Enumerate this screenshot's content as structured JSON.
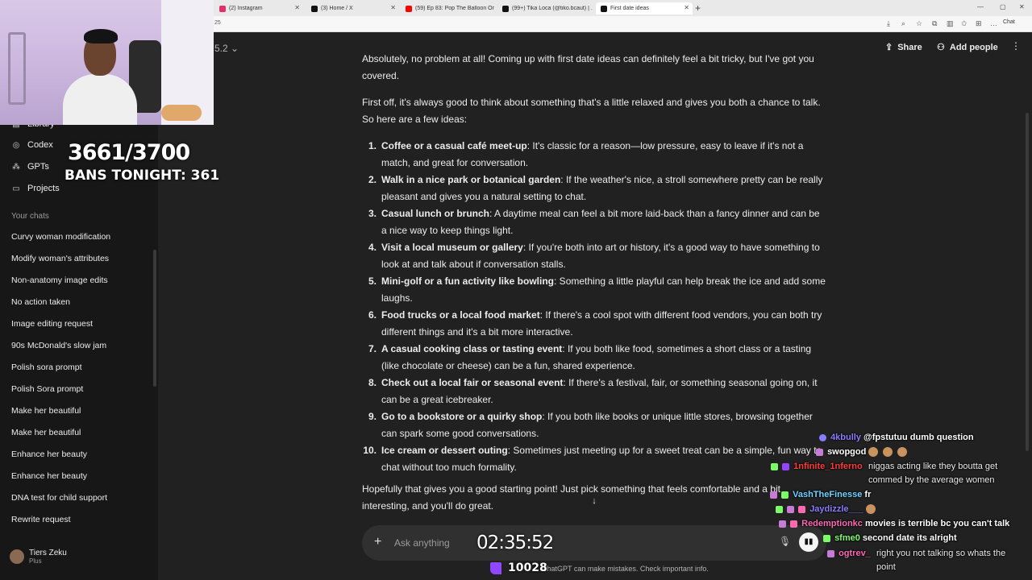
{
  "browser": {
    "tabs": [
      {
        "title": "(2) Instagram",
        "color": "#e1306c"
      },
      {
        "title": "(3) Home / X",
        "color": "#111111"
      },
      {
        "title": "(59) Ep 83: Pop The Balloon Or Fi...",
        "color": "#ff0000"
      },
      {
        "title": "(99+) Tika Loca (@tiko.bcaut) | ...",
        "color": "#111111"
      },
      {
        "title": "First date ideas",
        "color": "#111111"
      }
    ],
    "new_tab": "+",
    "address_fragment": "25",
    "chat_label": "Chat"
  },
  "stream": {
    "ban_count": "3661/3700",
    "bans_tonight": "BANS TONIGHT: 361",
    "timer": "02:35:52",
    "viewers": "10028"
  },
  "sidebar": {
    "top_items": [
      {
        "label": "Library",
        "icon": "library-icon"
      },
      {
        "label": "Codex",
        "icon": "codex-icon"
      },
      {
        "label": "GPTs",
        "icon": "gpts-icon"
      },
      {
        "label": "Projects",
        "icon": "folder-icon"
      }
    ],
    "section_label": "Your chats",
    "chats": [
      "Curvy woman modification",
      "Modify woman's attributes",
      "Non-anatomy image edits",
      "No action taken",
      "Image editing request",
      "90s McDonald's slow jam",
      "Polish sora prompt",
      "Polish Sora prompt",
      "Make her beautiful",
      "Make her beautiful",
      "Enhance her beauty",
      "Enhance her beauty",
      "DNA test for child support",
      "Rewrite request"
    ],
    "user": {
      "name": "Tiers Zeku",
      "plan": "Plus"
    }
  },
  "header": {
    "model": "5.2",
    "share_label": "Share",
    "add_people_label": "Add people"
  },
  "content": {
    "intro": "Absolutely, no problem at all! Coming up with first date ideas can definitely feel a bit tricky, but I've got you covered.",
    "lead": "First off, it's always good to think about something that's a little relaxed and gives you both a chance to talk. So here are a few ideas:",
    "ideas": [
      {
        "num": "1.",
        "title": "Coffee or a casual café meet-up",
        "text": ": It's classic for a reason—low pressure, easy to leave if it's not a match, and great for conversation."
      },
      {
        "num": "2.",
        "title": "Walk in a nice park or botanical garden",
        "text": ": If the weather's nice, a stroll somewhere pretty can be really pleasant and gives you a natural setting to chat."
      },
      {
        "num": "3.",
        "title": "Casual lunch or brunch",
        "text": ": A daytime meal can feel a bit more laid-back than a fancy dinner and can be a nice way to keep things light."
      },
      {
        "num": "4.",
        "title": "Visit a local museum or gallery",
        "text": ": If you're both into art or history, it's a good way to have something to look at and talk about if conversation stalls."
      },
      {
        "num": "5.",
        "title": "Mini-golf or a fun activity like bowling",
        "text": ": Something a little playful can help break the ice and add some laughs."
      },
      {
        "num": "6.",
        "title": "Food trucks or a local food market",
        "text": ": If there's a cool spot with different food vendors, you can both try different things and it's a bit more interactive."
      },
      {
        "num": "7.",
        "title": "A casual cooking class or tasting event",
        "text": ": If you both like food, sometimes a short class or a tasting (like chocolate or cheese) can be a fun, shared experience."
      },
      {
        "num": "8.",
        "title": "Check out a local fair or seasonal event",
        "text": ": If there's a festival, fair, or something seasonal going on, it can be a great icebreaker."
      },
      {
        "num": "9.",
        "title": "Go to a bookstore or a quirky shop",
        "text": ": If you both like books or unique little stores, browsing together can spark some good conversations."
      },
      {
        "num": "10.",
        "title": "Ice cream or dessert outing",
        "text": ": Sometimes just meeting up for a sweet treat can be a simple, fun way to chat without too much formality."
      }
    ],
    "closing": "Hopefully that gives you a good starting point! Just pick something that feels comfortable and a bit interesting, and you'll do great."
  },
  "composer": {
    "placeholder": "Ask anything",
    "disclaimer": "ChatGPT can make mistakes. Check important info."
  },
  "chat_overlay": [
    {
      "user": "4kbully",
      "color": "#8a7dff",
      "text": "@fpstutuu dumb question"
    },
    {
      "user": "swopgod",
      "color": "#ffffff",
      "text": ""
    },
    {
      "user": "1nfinite_1nferno",
      "color": "#ff3b3b",
      "text": "niggas acting like they boutta get commed by the average women"
    },
    {
      "user": "VashTheFinesse",
      "color": "#6fd3ff",
      "text": "fr"
    },
    {
      "user": "Jaydizzle___",
      "color": "#8a7dff",
      "text": ""
    },
    {
      "user": "Redemptionkc",
      "color": "#ff69b4",
      "text": "movies is terrible bc you can't talk"
    },
    {
      "user": "sfme0",
      "color": "#7cfc6a",
      "text": "second date its alright"
    },
    {
      "user": "ogtrev_",
      "color": "#ff69b4",
      "text": "right you not talking so whats the point"
    }
  ]
}
